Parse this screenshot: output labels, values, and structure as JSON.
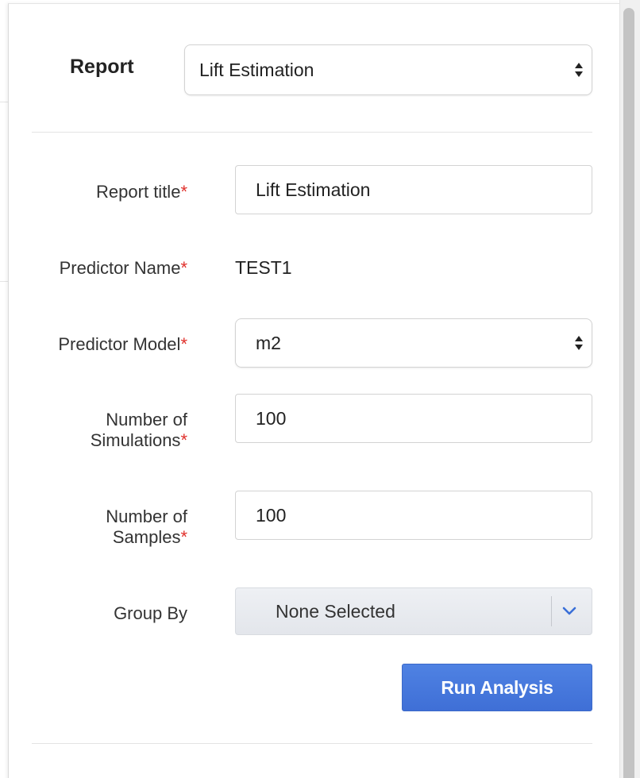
{
  "report": {
    "label": "Report",
    "selected": "Lift Estimation"
  },
  "form": {
    "report_title": {
      "label": "Report title",
      "required_mark": "*",
      "value": "Lift Estimation"
    },
    "predictor_name": {
      "label": "Predictor Name",
      "required_mark": "*",
      "value": "TEST1"
    },
    "predictor_model": {
      "label": "Predictor Model",
      "required_mark": "*",
      "selected": "m2"
    },
    "num_simulations": {
      "label_line1": "Number of",
      "label_line2": "Simulations",
      "required_mark": "*",
      "value": "100"
    },
    "num_samples": {
      "label_line1": "Number of",
      "label_line2": "Samples",
      "required_mark": "*",
      "value": "100"
    },
    "group_by": {
      "label": "Group By",
      "selected": "None Selected"
    }
  },
  "actions": {
    "run_label": "Run Analysis"
  },
  "icons": {
    "select_arrows": "up-down-arrows-icon",
    "dropdown": "chevron-down-icon"
  },
  "colors": {
    "required": "#e0302b",
    "primary_button": "#4677dd",
    "chevron": "#3a6fd8"
  }
}
